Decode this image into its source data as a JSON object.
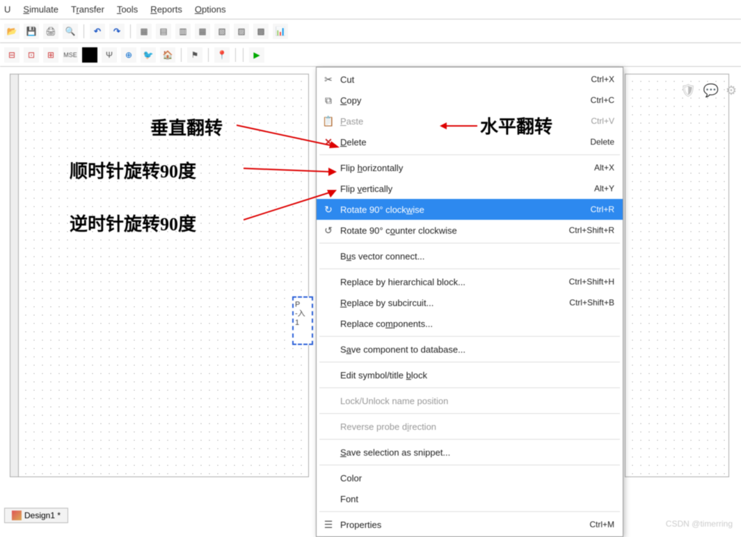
{
  "menubar": {
    "items": [
      "U",
      "Simulate",
      "Transfer",
      "Tools",
      "Reports",
      "Options"
    ]
  },
  "toolbar1": {
    "icons": [
      "folder",
      "save",
      "print",
      "cut",
      "undo",
      "redo",
      "",
      "table1",
      "table2",
      "cells1",
      "cells2",
      "cells3",
      "cells4",
      "cells5",
      "chart"
    ]
  },
  "toolbar2": {
    "icons": [
      "b1",
      "b2",
      "b3",
      "mse",
      "black",
      "ant",
      "wave",
      "sig",
      "home",
      "",
      "flag",
      "",
      "pin",
      "",
      "",
      "play"
    ]
  },
  "selection": {
    "line1": "P",
    "line2": "-入",
    "line3": "1"
  },
  "contextmenu": {
    "items": [
      {
        "icon": "scissors",
        "label": "Cut",
        "shortcut": "Ctrl+X",
        "enabled": true
      },
      {
        "icon": "copy",
        "label": "Copy",
        "shortcut": "Ctrl+C",
        "enabled": true
      },
      {
        "icon": "paste",
        "label": "Paste",
        "shortcut": "Ctrl+V",
        "enabled": false
      },
      {
        "icon": "x",
        "label": "Delete",
        "shortcut": "Delete",
        "enabled": true
      },
      {
        "sep": true
      },
      {
        "icon": "",
        "label": "Flip horizontally",
        "shortcut": "Alt+X",
        "enabled": true
      },
      {
        "icon": "",
        "label": "Flip vertically",
        "shortcut": "Alt+Y",
        "enabled": true
      },
      {
        "icon": "rotcw",
        "label": "Rotate 90° clockwise",
        "shortcut": "Ctrl+R",
        "enabled": true,
        "selected": true
      },
      {
        "icon": "rotccw",
        "label": "Rotate 90° counter clockwise",
        "shortcut": "Ctrl+Shift+R",
        "enabled": true
      },
      {
        "sep": true
      },
      {
        "icon": "",
        "label": "Bus vector connect...",
        "shortcut": "",
        "enabled": true
      },
      {
        "sep": true
      },
      {
        "icon": "",
        "label": "Replace by hierarchical block...",
        "shortcut": "Ctrl+Shift+H",
        "enabled": true
      },
      {
        "icon": "",
        "label": "Replace by subcircuit...",
        "shortcut": "Ctrl+Shift+B",
        "enabled": true
      },
      {
        "icon": "",
        "label": "Replace components...",
        "shortcut": "",
        "enabled": true
      },
      {
        "sep": true
      },
      {
        "icon": "",
        "label": "Save component to database...",
        "shortcut": "",
        "enabled": true
      },
      {
        "sep": true
      },
      {
        "icon": "",
        "label": "Edit symbol/title block",
        "shortcut": "",
        "enabled": true
      },
      {
        "sep": true
      },
      {
        "icon": "",
        "label": "Lock/Unlock name position",
        "shortcut": "",
        "enabled": false
      },
      {
        "sep": true
      },
      {
        "icon": "",
        "label": "Reverse probe direction",
        "shortcut": "",
        "enabled": false
      },
      {
        "sep": true
      },
      {
        "icon": "",
        "label": "Save selection as snippet...",
        "shortcut": "",
        "enabled": true
      },
      {
        "sep": true
      },
      {
        "icon": "",
        "label": "Color",
        "shortcut": "",
        "enabled": true
      },
      {
        "icon": "",
        "label": "Font",
        "shortcut": "",
        "enabled": true
      },
      {
        "sep": true
      },
      {
        "icon": "props",
        "label": "Properties",
        "shortcut": "Ctrl+M",
        "enabled": true
      }
    ]
  },
  "annotations": {
    "flip_vertical": "垂直翻转",
    "flip_horizontal": "水平翻转",
    "rotate_cw": "顺时针旋转90度",
    "rotate_ccw": "逆时针旋转90度"
  },
  "tab": {
    "label": "Design1 *"
  },
  "watermark": "CSDN @timerring"
}
